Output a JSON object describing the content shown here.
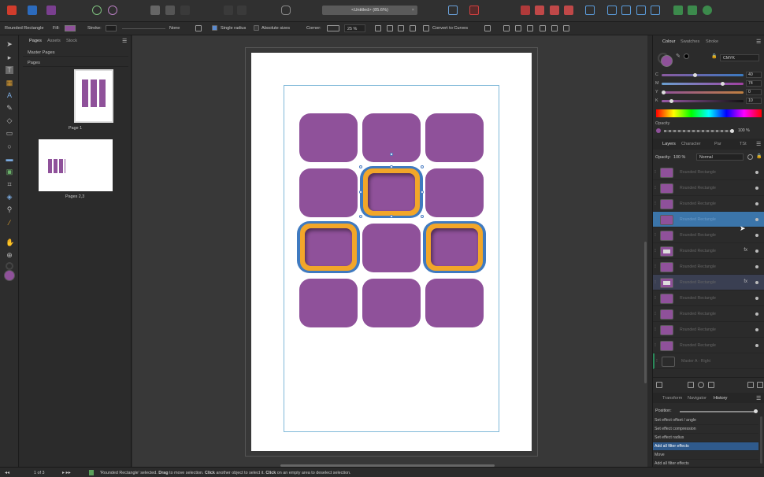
{
  "colors": {
    "purple": "#8f519a",
    "blue_stroke": "#3f7ac0",
    "orange_ring": "#f2a629",
    "selection_blue": "#3b75aa"
  },
  "toolbar": {
    "document_title": "<Untitled> (85.6%)",
    "close_glyph": "×"
  },
  "context": {
    "selection_type": "Rounded Rectangle",
    "fill_label": "Fill:",
    "stroke_label": "Stroke:",
    "stroke_style": "None",
    "single_radius": "Single radius",
    "absolute_sizes": "Absolute sizes",
    "corner_label": "Corner:",
    "corner_value": "25 %",
    "convert_button": "Convert to Curves"
  },
  "left_panel": {
    "tabs": [
      "Pages",
      "Assets",
      "Stock"
    ],
    "master_pages": "Master Pages",
    "pages_section": "Pages",
    "page1_label": "Page 1",
    "page23_label": "Pages 2,3"
  },
  "right_panel": {
    "color_tabs": [
      "Colour",
      "Swatches",
      "Stroke"
    ],
    "color_model": "CMYK",
    "channels": [
      {
        "label": "C",
        "value": "40"
      },
      {
        "label": "M",
        "value": "74"
      },
      {
        "label": "Y",
        "value": "0"
      },
      {
        "label": "K",
        "value": "10"
      }
    ],
    "opacity_label": "Opacity",
    "opacity_value": "100 %",
    "layer_tabs": [
      "Layers",
      "Character",
      "Par",
      "TSt"
    ],
    "layer_opacity_label": "Opacity:",
    "layer_opacity_value": "100 %",
    "blend_mode": "Normal",
    "layers": [
      {
        "name": "Rounded Rectangle",
        "state": ""
      },
      {
        "name": "Rounded Rectangle",
        "state": ""
      },
      {
        "name": "Rounded Rectangle",
        "state": ""
      },
      {
        "name": "Rounded Rectangle",
        "state": "sel"
      },
      {
        "name": "Rounded Rectangle",
        "state": ""
      },
      {
        "name": "Rounded Rectangle",
        "state": "fx"
      },
      {
        "name": "Rounded Rectangle",
        "state": ""
      },
      {
        "name": "Rounded Rectangle",
        "state": "sel2fx"
      },
      {
        "name": "Rounded Rectangle",
        "state": ""
      },
      {
        "name": "Rounded Rectangle",
        "state": ""
      },
      {
        "name": "Rounded Rectangle",
        "state": ""
      },
      {
        "name": "Rounded Rectangle",
        "state": ""
      },
      {
        "name": "Master A - Right",
        "state": "master"
      }
    ],
    "fx_glyph": "fx",
    "bottom_tabs": [
      "Transform",
      "Navigator",
      "History"
    ],
    "position_label": "Position:",
    "history": [
      {
        "label": "Set effect offset / angle",
        "selected": false
      },
      {
        "label": "Set effect compression",
        "selected": false
      },
      {
        "label": "Set effect radius",
        "selected": false
      },
      {
        "label": "Add all filter effects",
        "selected": true
      },
      {
        "label": "Move",
        "selected": false
      },
      {
        "label": "Add all filter effects",
        "selected": false
      }
    ]
  },
  "status": {
    "page_counter": "1 of 3",
    "s1": "'Rounded Rectangle' selected. ",
    "s2": "Drag",
    "s3": " to move selection. ",
    "s4": "Click",
    "s5": " another object to select it. ",
    "s6": "Click",
    "s7": " on an empty area to deselect selection."
  }
}
